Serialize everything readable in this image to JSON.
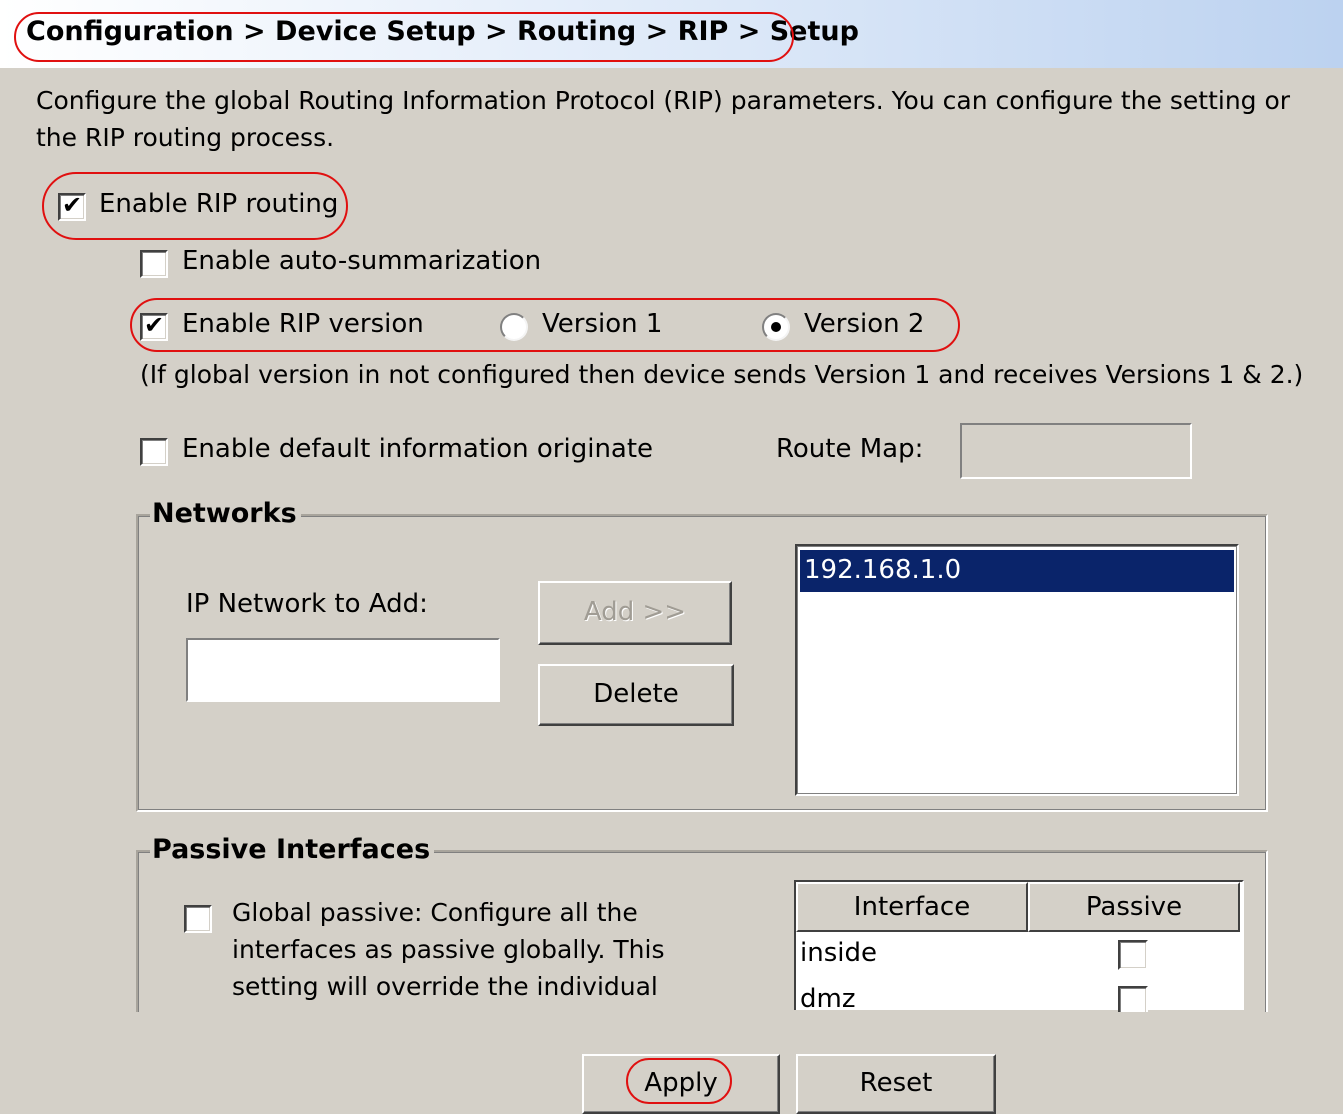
{
  "breadcrumb": [
    "Configuration",
    "Device Setup",
    "Routing",
    "RIP",
    "Setup"
  ],
  "breadcrumb_text": "Configuration > Device Setup > Routing > RIP > Setup",
  "description": {
    "line1": "Configure the global Routing Information Protocol (RIP) parameters. You can configure the setting or",
    "line2": "the RIP routing process."
  },
  "enable_rip_routing": {
    "label": "Enable RIP routing",
    "checked": true
  },
  "enable_auto_summarization": {
    "label": "Enable auto-summarization",
    "checked": false
  },
  "enable_rip_version": {
    "label": "Enable RIP version",
    "checked": true,
    "options": [
      "Version 1",
      "Version 2"
    ],
    "selected": "Version 2"
  },
  "version_note": "(If global version in not configured then device sends Version 1 and receives Versions 1 & 2.)",
  "default_info_originate": {
    "label": "Enable default information originate",
    "checked": false
  },
  "route_map": {
    "label": "Route Map:",
    "value": ""
  },
  "networks": {
    "title": "Networks",
    "ip_label": "IP Network to Add:",
    "ip_value": "",
    "add_label": "Add >>",
    "delete_label": "Delete",
    "items": [
      "192.168.1.0"
    ],
    "selected_index": 0
  },
  "passive_interfaces": {
    "title": "Passive Interfaces",
    "global_passive_text": [
      "Global passive: Configure all the",
      "interfaces as passive globally. This",
      "setting will override the individual"
    ],
    "global_passive_checked": false,
    "columns": [
      "Interface",
      "Passive"
    ],
    "rows": [
      {
        "interface": "inside",
        "passive": false
      },
      {
        "interface": "dmz",
        "passive": false
      }
    ]
  },
  "footer": {
    "apply_label": "Apply",
    "reset_label": "Reset"
  },
  "colors": {
    "annotation": "#e01010",
    "selection": "#0a246a",
    "background": "#d4d0c8"
  }
}
